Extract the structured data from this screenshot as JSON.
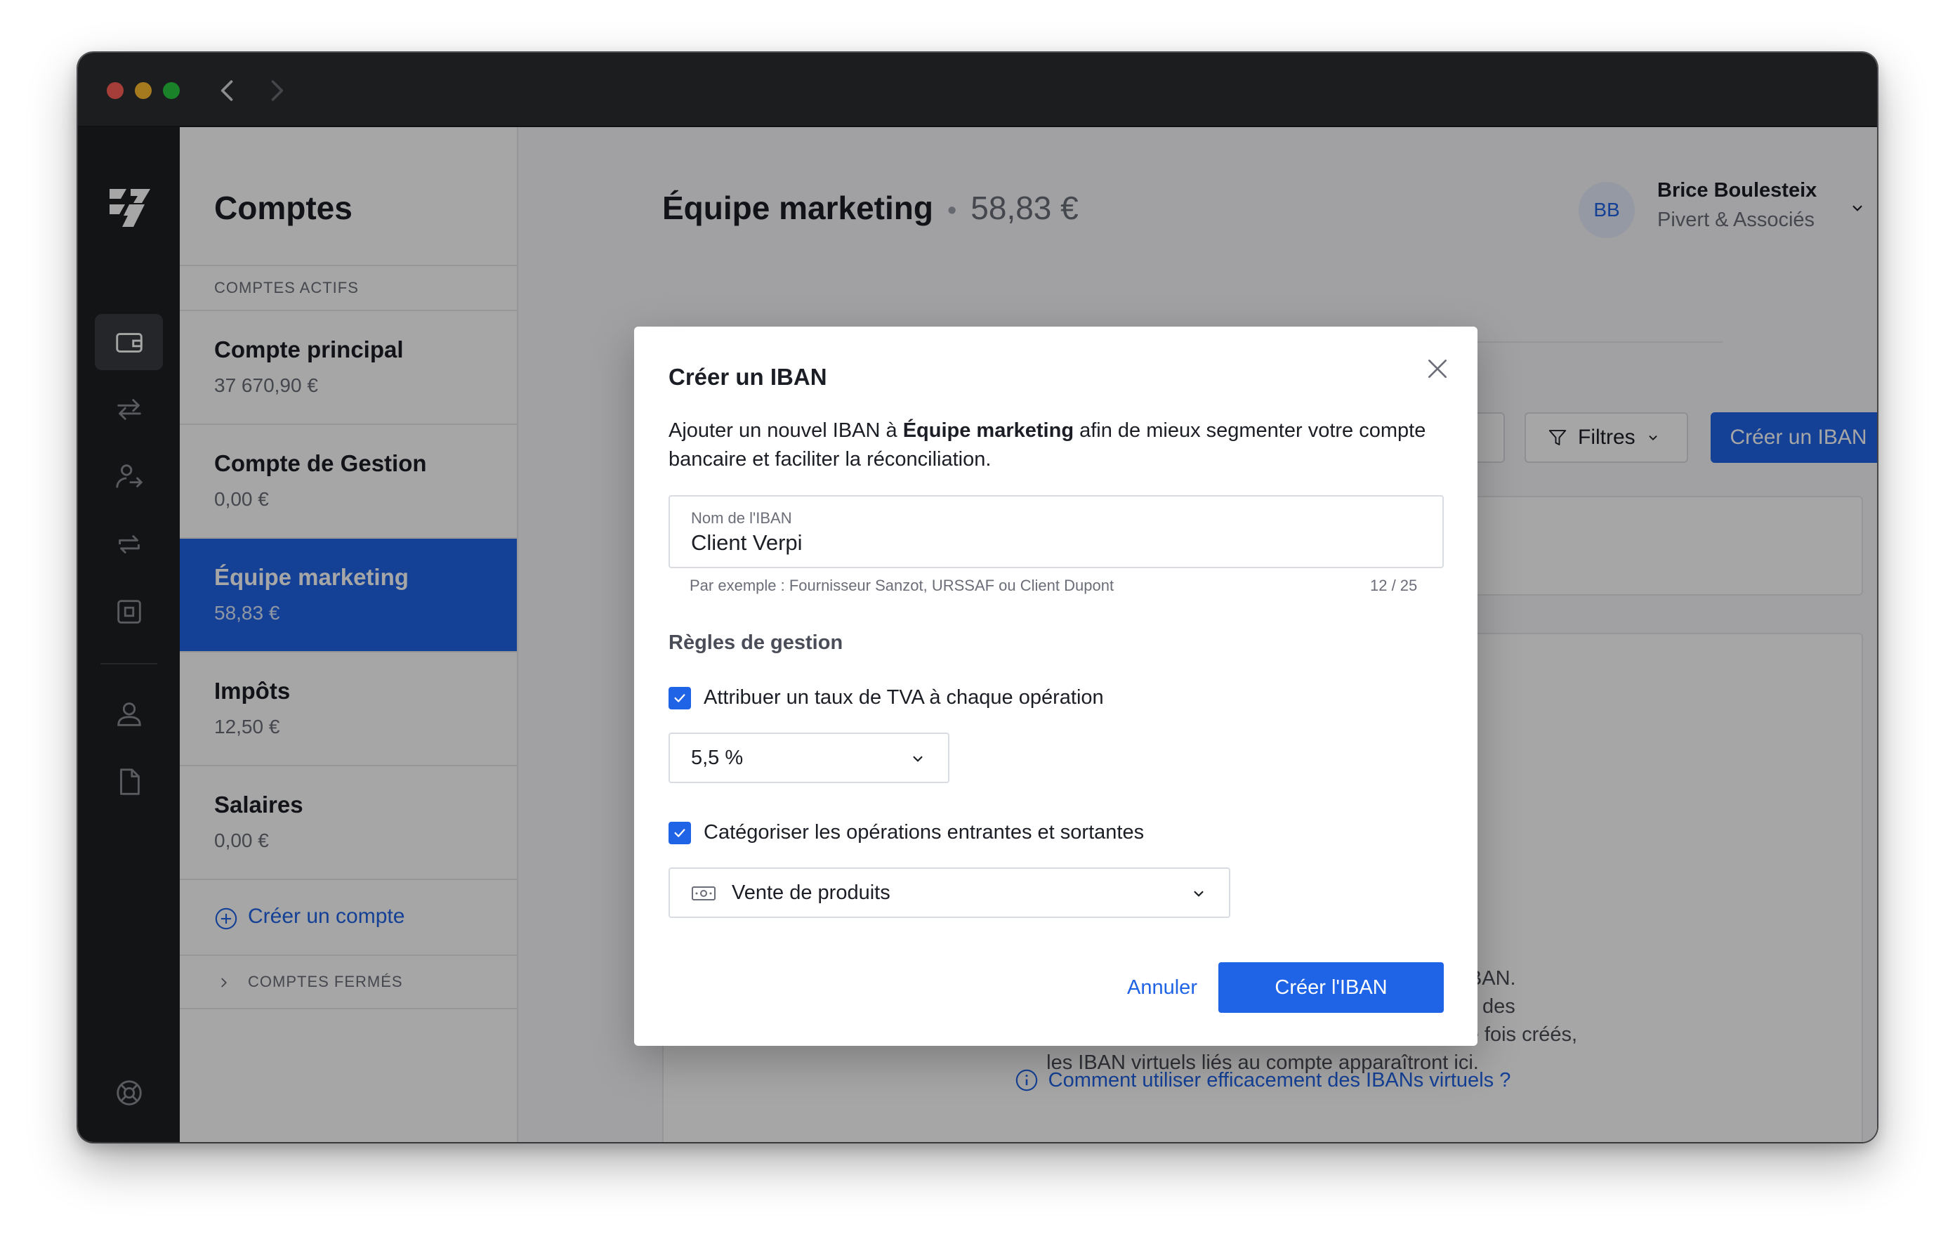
{
  "sidebar": {
    "title": "Comptes",
    "section_active": "COMPTES ACTIFS",
    "accounts": [
      {
        "name": "Compte principal",
        "amount": "37 670,90 €"
      },
      {
        "name": "Compte de Gestion",
        "amount": "0,00 €"
      },
      {
        "name": "Équipe marketing",
        "amount": "58,83 €"
      },
      {
        "name": "Impôts",
        "amount": "12,50 €"
      },
      {
        "name": "Salaires",
        "amount": "0,00 €"
      }
    ],
    "create_account": "Créer un compte",
    "section_closed": "COMPTES FERMÉS"
  },
  "header": {
    "title": "Équipe marketing",
    "balance": "58,83 €",
    "user_initials": "BB",
    "user_name": "Brice Boulesteix",
    "user_company": "Pivert & Associés"
  },
  "toolbar": {
    "filters_label": "Filtres",
    "create_iban_label": "Créer un IBAN"
  },
  "empty_state": {
    "text_line1": "n seul IBAN.",
    "text_line2": "ez créer des",
    "text_line3": "IBAN virtuels, en complément de votre IBAN principal. Une fois créés,",
    "text_line4": "les IBAN virtuels liés au compte apparaîtront ici.",
    "help_link": "Comment utiliser efficacement des IBANs virtuels ?"
  },
  "modal": {
    "title": "Créer un IBAN",
    "desc_prefix": "Ajouter un nouvel IBAN à ",
    "desc_bold": "Équipe marketing",
    "desc_suffix": " afin de mieux segmenter votre compte bancaire et faciliter la réconciliation.",
    "field_label": "Nom de l'IBAN",
    "field_value": "Client Verpi",
    "field_help": "Par exemple : Fournisseur Sanzot, URSSAF ou Client Dupont",
    "field_count": "12 / 25",
    "rules_title": "Règles de gestion",
    "rule_vat_label": "Attribuer un taux de TVA à chaque opération",
    "rule_vat_value": "5,5 %",
    "rule_cat_label": "Catégoriser les opérations entrantes et sortantes",
    "rule_cat_value": "Vente de produits",
    "cancel_label": "Annuler",
    "confirm_label": "Créer l'IBAN"
  },
  "colors": {
    "accent": "#1f63e6",
    "rail_bg": "#1e1f23",
    "titlebar_bg": "#2c2d31"
  }
}
